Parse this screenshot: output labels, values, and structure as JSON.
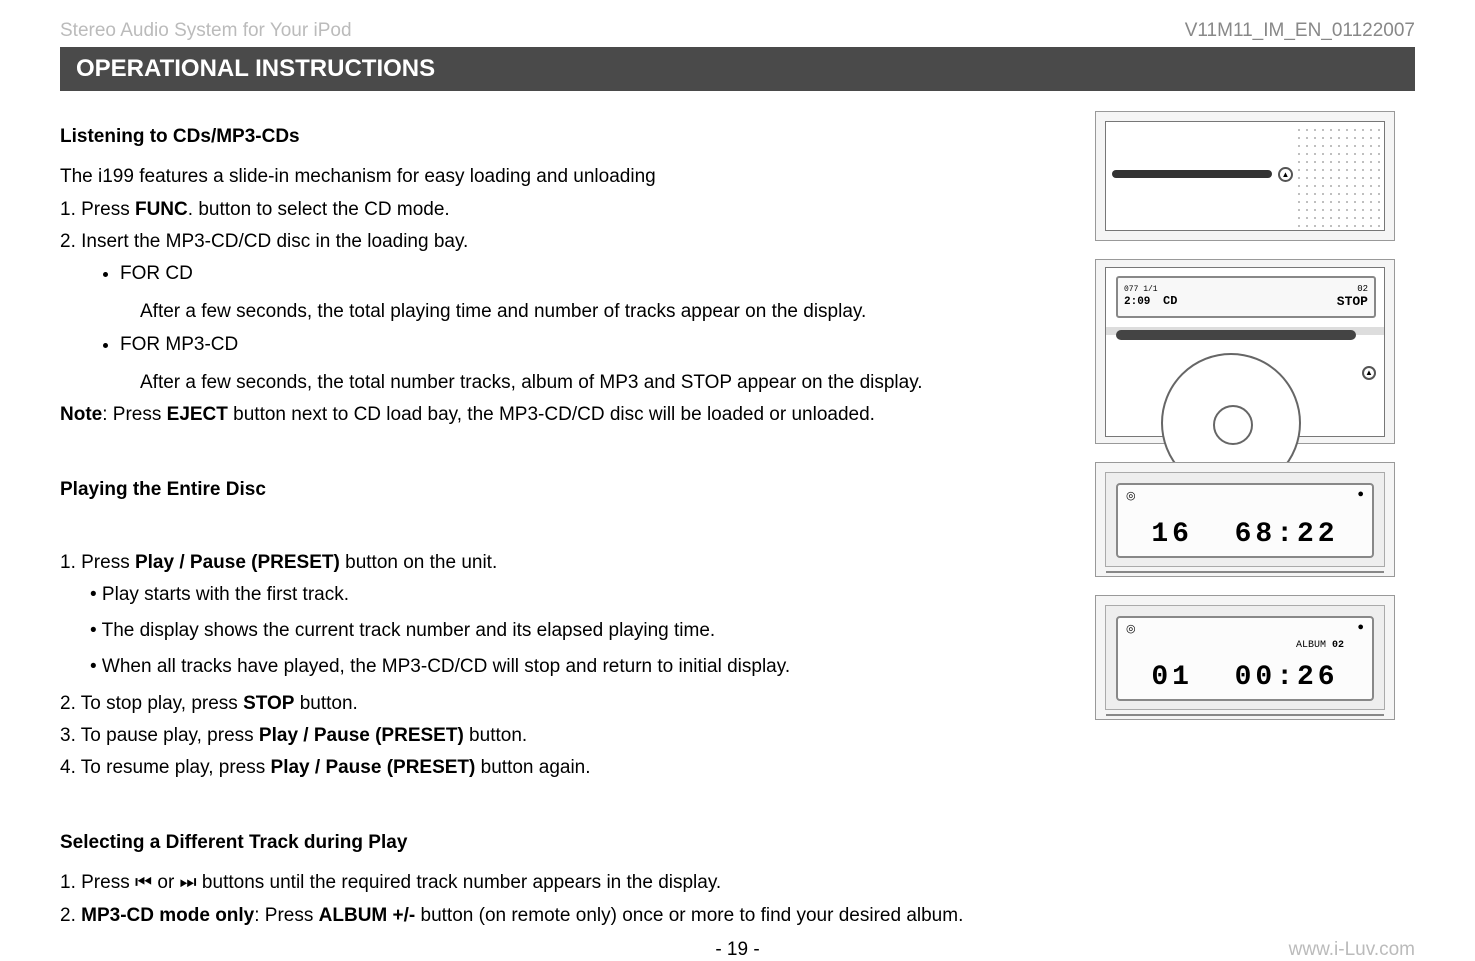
{
  "header": {
    "left": "Stereo Audio System for Your iPod",
    "right": "V11M11_IM_EN_01122007"
  },
  "section_title": "OPERATIONAL INSTRUCTIONS",
  "block1": {
    "heading": "Listening to CDs/MP3-CDs",
    "intro": "The i199 features a slide-in mechanism for easy loading and unloading",
    "step1_pre": "1. Press ",
    "step1_bold": "FUNC",
    "step1_post": ". button to select the CD mode.",
    "step2": "2. Insert the MP3-CD/CD disc in the loading bay.",
    "bullet1": "FOR CD",
    "bullet1_desc": "After a few seconds, the total playing time and number of tracks appear on the display.",
    "bullet2": "FOR MP3-CD",
    "bullet2_desc": "After a few seconds, the total number tracks, album of MP3 and STOP appear on the display.",
    "note_pre": "Note",
    "note_mid": ": Press ",
    "note_bold": "EJECT",
    "note_post": " button next to CD load bay, the MP3-CD/CD disc will be loaded or unloaded."
  },
  "block2": {
    "heading": "Playing the Entire Disc",
    "s1_pre": "1.  Press ",
    "s1_bold": "Play / Pause (PRESET)",
    "s1_post": " button on the unit.",
    "s1b1": "•  Play starts with the first track.",
    "s1b2": "•  The display shows the current track number and its elapsed playing time.",
    "s1b3": "•  When all tracks have played, the MP3-CD/CD will stop and return to initial display.",
    "s2_pre": "2.  To stop play, press ",
    "s2_bold": "STOP",
    "s2_post": " button.",
    "s3_pre": "3.  To pause play, press ",
    "s3_bold": "Play / Pause (PRESET)",
    "s3_post": " button.",
    "s4_pre": "4.  To resume play, press ",
    "s4_bold": "Play / Pause (PRESET)",
    "s4_post": " button again."
  },
  "block3": {
    "heading": "Selecting a Different Track during Play",
    "s1_pre": "1.  Press ",
    "s1_icon1": "⏮",
    "s1_mid": " or ",
    "s1_icon2": "⏭",
    "s1_post": " buttons until the required track number appears in the display.",
    "s2_pre": "2.  ",
    "s2_bold1": "MP3-CD mode only",
    "s2_mid": ": Press ",
    "s2_bold2": "ALBUM +/-",
    "s2_post": " button (on remote only) once or more to find your desired album."
  },
  "diagrams": {
    "d2_lcd_left_top": "077 1/1",
    "d2_lcd_left": "2:09",
    "d2_lcd_mode": "CD",
    "d2_lcd_stop": "STOP",
    "d2_lcd_small": "02",
    "d3_track": "16",
    "d3_time": "68:22",
    "d4_album_label": "ALBUM",
    "d4_album_num": "02",
    "d4_track": "01",
    "d4_time": "00:26"
  },
  "footer": {
    "page": "- 19 -",
    "url": "www.i-Luv.com"
  }
}
